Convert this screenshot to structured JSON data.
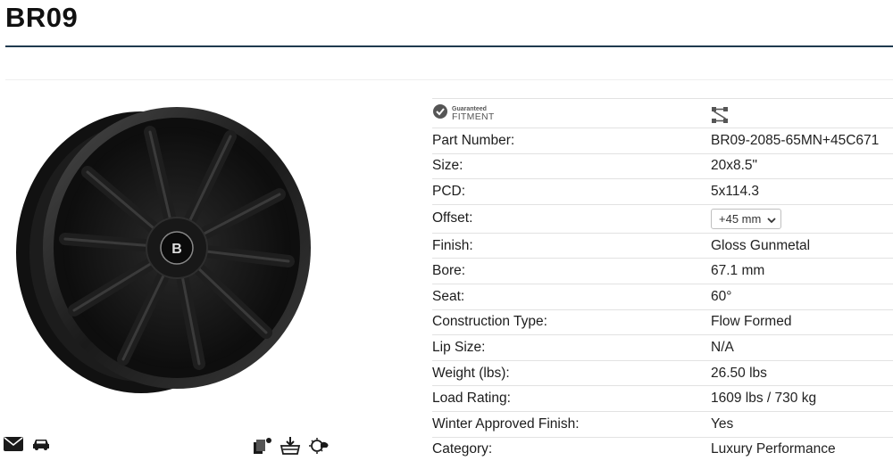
{
  "product": {
    "title": "BR09"
  },
  "fitment": {
    "small_label": "Guaranteed",
    "big_label": "FITMENT"
  },
  "specs": [
    {
      "label": "Part Number:",
      "value": "BR09-2085-65MN+45C671"
    },
    {
      "label": "Size:",
      "value": "20x8.5\""
    },
    {
      "label": "PCD:",
      "value": "5x114.3"
    },
    {
      "label": "Offset:",
      "value": "+45 mm"
    },
    {
      "label": "Finish:",
      "value": "Gloss Gunmetal"
    },
    {
      "label": "Bore:",
      "value": "67.1 mm"
    },
    {
      "label": "Seat:",
      "value": "60°"
    },
    {
      "label": "Construction Type:",
      "value": "Flow Formed"
    },
    {
      "label": "Lip Size:",
      "value": "N/A"
    },
    {
      "label": "Weight (lbs):",
      "value": "26.50 lbs"
    },
    {
      "label": "Load Rating:",
      "value": "1609 lbs / 730 kg"
    },
    {
      "label": "Winter Approved Finish:",
      "value": "Yes"
    },
    {
      "label": "Category:",
      "value": "Luxury Performance"
    }
  ],
  "icons": {
    "email": "envelope-icon",
    "vehicle": "car-icon",
    "compare": "compare-icon",
    "install": "install-icon",
    "winter": "winter-weather-icon",
    "fitment": "fitment-check-icon",
    "axle": "axle-icon"
  },
  "colors": {
    "title_rule": "#1f3a4f",
    "wheel": "#1a1a1a"
  }
}
